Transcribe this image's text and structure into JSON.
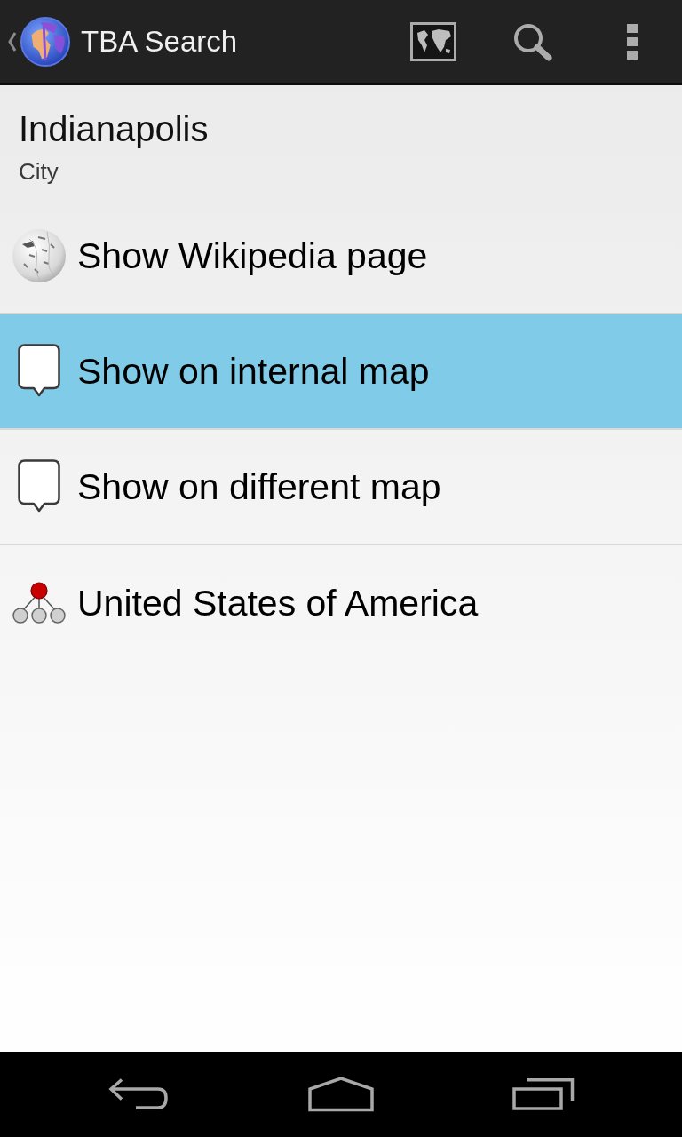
{
  "action_bar": {
    "title": "TBA Search"
  },
  "header": {
    "title": "Indianapolis",
    "subtitle": "City"
  },
  "items": [
    {
      "kind": "wikipedia",
      "label": "Show Wikipedia page",
      "selected": false
    },
    {
      "kind": "marker",
      "label": "Show on internal map",
      "selected": true
    },
    {
      "kind": "marker",
      "label": "Show on different map",
      "selected": false
    },
    {
      "kind": "hierarchy",
      "label": "United States of America",
      "selected": false
    }
  ]
}
